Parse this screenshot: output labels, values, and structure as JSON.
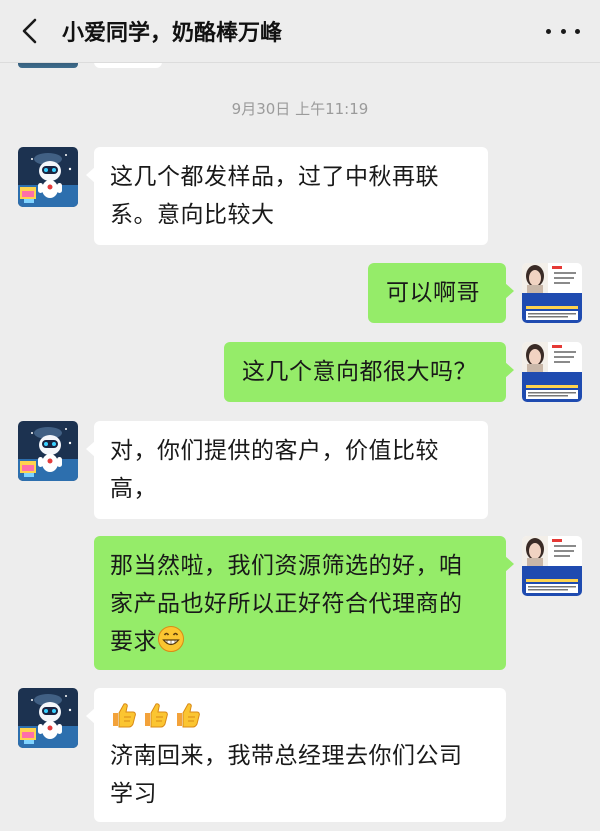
{
  "header": {
    "title": "小爱同学，奶酪棒万峰",
    "back_icon": "chevron-left-icon",
    "more_icon": "more-dots-icon"
  },
  "timestamp": "9月30日 上午11:19",
  "colors": {
    "background": "#ededed",
    "incoming_bubble": "#ffffff",
    "outgoing_bubble": "#95ec69",
    "timestamp_text": "#9b9b9b"
  },
  "my_avatar": {
    "name": "梅梦",
    "banner_title": "快消天下",
    "banner_subtitle": "专业快消招代理批发平台"
  },
  "messages": [
    {
      "from": "contact",
      "lines": [
        "这几个都发样品，过了中秋再联",
        "系。意向比较大"
      ]
    },
    {
      "from": "me",
      "lines": [
        "可以啊哥"
      ]
    },
    {
      "from": "me",
      "lines": [
        "这几个意向都很大吗？"
      ]
    },
    {
      "from": "contact",
      "lines": [
        "对，你们提供的客户，价值比较",
        "高，"
      ]
    },
    {
      "from": "me",
      "lines": [
        "那当然啦，我们资源筛选的好，咱",
        "家产品也好所以正好符合代理商的",
        "要求"
      ],
      "trailing_emoji": "grinning-face-emoji"
    },
    {
      "from": "contact",
      "emoji_line": [
        "thumbs-up-emoji",
        "thumbs-up-emoji",
        "thumbs-up-emoji"
      ],
      "lines": [
        "济南回来，我带总经理去你们公司",
        "学习"
      ]
    }
  ]
}
